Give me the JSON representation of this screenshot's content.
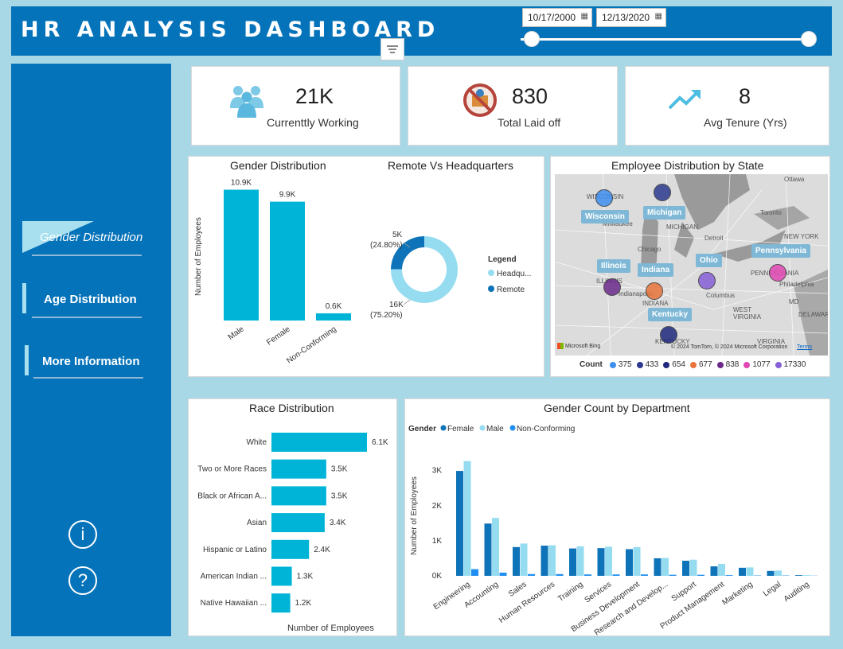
{
  "header": {
    "title": "HR ANALYSIS DASHBOARD",
    "date_from": "10/17/2000",
    "date_to": "12/13/2020"
  },
  "sidebar": {
    "items": [
      {
        "label": "Gender Distribution"
      },
      {
        "label": "Age Distribution"
      },
      {
        "label": "More Information"
      }
    ],
    "info_symbol": "i",
    "help_symbol": "?"
  },
  "kpis": [
    {
      "value": "21K",
      "label": "Currenttly Working",
      "icon": "people-icon"
    },
    {
      "value": "830",
      "label": "Total Laid off",
      "icon": "no-worker-icon"
    },
    {
      "value": "8",
      "label": "Avg Tenure (Yrs)",
      "icon": "trend-up-icon"
    }
  ],
  "gender_chart": {
    "title": "Gender Distribution",
    "ylabel": "Number of Employees",
    "categories": [
      "Male",
      "Female",
      "Non-Conforming"
    ],
    "labels": [
      "10.9K",
      "9.9K",
      "0.6K"
    ],
    "values": [
      10.9,
      9.9,
      0.6
    ]
  },
  "remote_chart": {
    "title": "Remote Vs Headquarters",
    "legend_title": "Legend",
    "legend": [
      "Headqu...",
      "Remote"
    ],
    "remote_label": "5K",
    "remote_pct": "(24.80%)",
    "hq_label": "16K",
    "hq_pct": "(75.20%)",
    "remote_share": 0.248
  },
  "map": {
    "title": "Employee Distribution by State",
    "states": [
      "Wisconsin",
      "Michigan",
      "Illinois",
      "Indiana",
      "Ohio",
      "Pennsylvania",
      "Kentucky"
    ],
    "places": [
      "Ottawa",
      "WISCONSIN",
      "Milwaukee",
      "MICHIGAN",
      "Toronto",
      "NEW YORK",
      "Detroit",
      "Chicago",
      "ILLINOIS",
      "Indianapolis",
      "INDIANA",
      "Columbus",
      "WEST VIRGINIA",
      "PENNSYLVANIA",
      "Philadelphia",
      "MD",
      "DELAWARE",
      "VIRGINIA",
      "KENTUCKY"
    ],
    "attribution": "Microsoft Bing",
    "copyright": "© 2024 TomTom, © 2024 Microsoft Corporation",
    "terms": "Terms",
    "legend_title": "Count",
    "counts": [
      "375",
      "433",
      "654",
      "677",
      "838",
      "1077",
      "17330"
    ],
    "colors": [
      "#3f8ff0",
      "#2b3a8f",
      "#1f2a7c",
      "#e8743b",
      "#6b2a8a",
      "#e047b4",
      "#8660d6"
    ]
  },
  "race_chart": {
    "title": "Race Distribution",
    "xlabel": "Number of Employees",
    "categories": [
      "White",
      "Two or More Races",
      "Black or African A...",
      "Asian",
      "Hispanic or Latino",
      "American Indian ...",
      "Native Hawaiian ..."
    ],
    "labels": [
      "6.1K",
      "3.5K",
      "3.5K",
      "3.4K",
      "2.4K",
      "1.3K",
      "1.2K"
    ],
    "values": [
      6.1,
      3.5,
      3.5,
      3.4,
      2.4,
      1.3,
      1.2
    ]
  },
  "chart_data": {
    "type": "bar",
    "title": "Gender Count by Department",
    "legend_title": "Gender",
    "ylabel": "Number of Employees",
    "yticks": [
      "3K",
      "2K",
      "1K",
      "0K"
    ],
    "ylim": [
      0,
      3400
    ],
    "categories": [
      "Engineering",
      "Accounting",
      "Sales",
      "Human Resources",
      "Training",
      "Services",
      "Business Development",
      "Research and Develop...",
      "Support",
      "Product Management",
      "Marketing",
      "Legal",
      "Auditing"
    ],
    "series": [
      {
        "name": "Female",
        "color": "#0e73b8",
        "values": [
          2990,
          1490,
          820,
          860,
          780,
          790,
          760,
          500,
          430,
          270,
          230,
          140,
          20
        ]
      },
      {
        "name": "Male",
        "color": "#96dcf0",
        "values": [
          3270,
          1650,
          920,
          870,
          840,
          830,
          820,
          510,
          460,
          340,
          240,
          150,
          20
        ]
      },
      {
        "name": "Non-Conforming",
        "color": "#1f8ef0",
        "values": [
          190,
          90,
          50,
          50,
          40,
          40,
          40,
          30,
          30,
          20,
          10,
          10,
          5
        ]
      }
    ]
  }
}
